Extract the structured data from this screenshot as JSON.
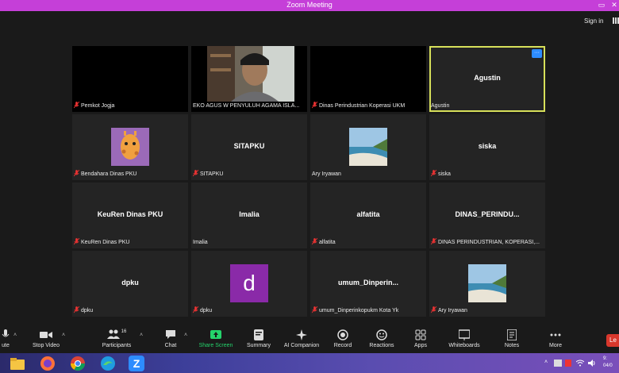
{
  "window": {
    "title": "Zoom Meeting",
    "restore_glyph": "▭",
    "close_glyph": "✕"
  },
  "header": {
    "sign_in": "Sign in"
  },
  "tiles": [
    {
      "label": "Pemkot Jogja",
      "center": "",
      "muted": true
    },
    {
      "label": "EKO AGUS W PENYULUH AGAMA ISLA...",
      "center": "",
      "muted": false
    },
    {
      "label": "Dinas Perindustrian Koperasi UKM",
      "center": "",
      "muted": true
    },
    {
      "label": "Agustin",
      "center": "Agustin",
      "muted": false,
      "menu": "···"
    },
    {
      "label": "Bendahara Dinas PKU",
      "center": "",
      "muted": true
    },
    {
      "label": "SITAPKU",
      "center": "SITAPKU",
      "muted": true
    },
    {
      "label": "Ary Iryawan",
      "center": "",
      "muted": false
    },
    {
      "label": "siska",
      "center": "siska",
      "muted": true
    },
    {
      "label": "KeuRen Dinas PKU",
      "center": "KeuRen Dinas PKU",
      "muted": true
    },
    {
      "label": "Imalia",
      "center": "Imalia",
      "muted": false
    },
    {
      "label": "alfatita",
      "center": "alfatita",
      "muted": true
    },
    {
      "label": "DINAS PERINDUSTRIAN, KOPERASI,...",
      "center": "DINAS_PERINDU...",
      "muted": true
    },
    {
      "label": "dpku",
      "center": "dpku",
      "muted": true
    },
    {
      "label": "dpku",
      "center": "",
      "avatar_letter": "d",
      "muted": true
    },
    {
      "label": "umum_Dinperinkopukm Kota Yk",
      "center": "umum_Dinperin...",
      "muted": true
    },
    {
      "label": "Ary Iryawan",
      "center": "",
      "muted": true
    }
  ],
  "toolbar": {
    "mute": "ute",
    "stop_video": "Stop Video",
    "participants": "Participants",
    "participants_count": "16",
    "chat": "Chat",
    "share_screen": "Share Screen",
    "summary": "Summary",
    "ai_companion": "AI Companion",
    "record": "Record",
    "reactions": "Reactions",
    "apps": "Apps",
    "whiteboards": "Whiteboards",
    "notes": "Notes",
    "more": "More",
    "leave": "Le"
  },
  "taskbar": {
    "time": "9:",
    "date": "04/0",
    "tray_caret": "˄"
  },
  "colors": {
    "title_bar": "#c53fd8",
    "active_border": "#d7e05a",
    "accent_green": "#24d36b",
    "leave_red": "#d9372c",
    "avatar_purple": "#8a2aa8"
  }
}
